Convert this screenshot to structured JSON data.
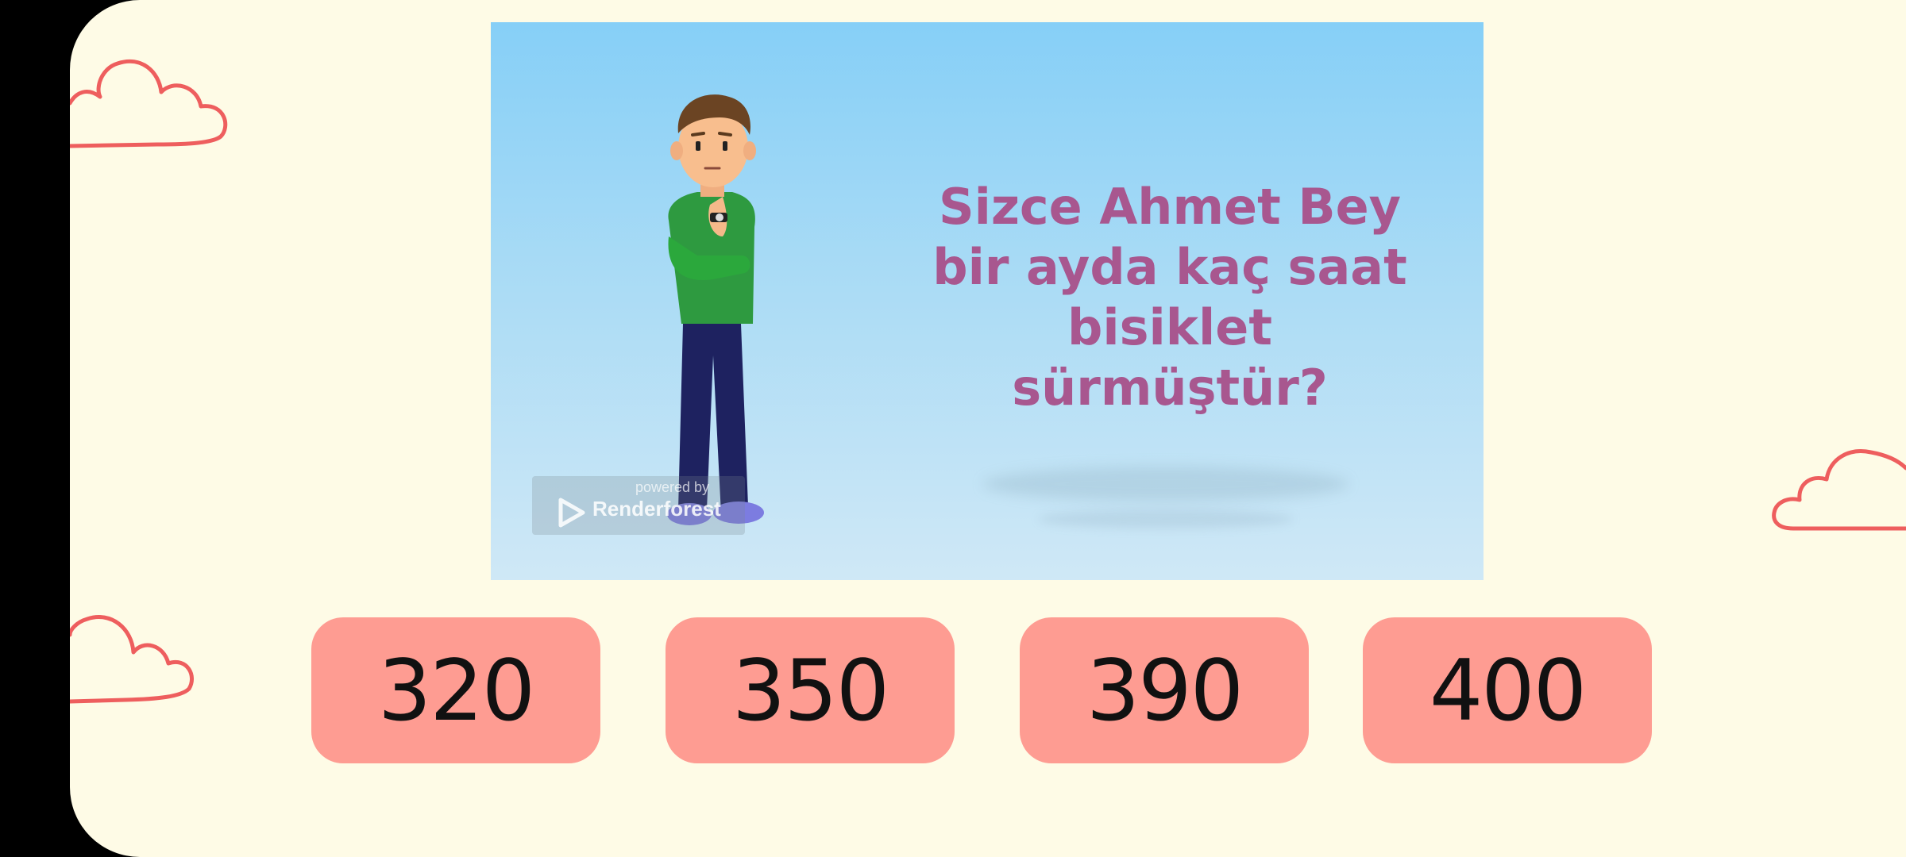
{
  "colors": {
    "background": "#FEFBE6",
    "answer_bg": "#FE9C92",
    "question_text": "#A8578F",
    "cloud_stroke": "#EE5E5E"
  },
  "video": {
    "question": "Sizce Ahmet Bey bir ayda kaç saat bisiklet sürmüştür?",
    "watermark": {
      "powered_by": "powered by",
      "brand": "Renderforest"
    }
  },
  "answers": [
    {
      "label": "320"
    },
    {
      "label": "350"
    },
    {
      "label": "390"
    },
    {
      "label": "400"
    }
  ],
  "decorations": [
    "cloud-icon",
    "cloud-icon",
    "cloud-icon"
  ]
}
